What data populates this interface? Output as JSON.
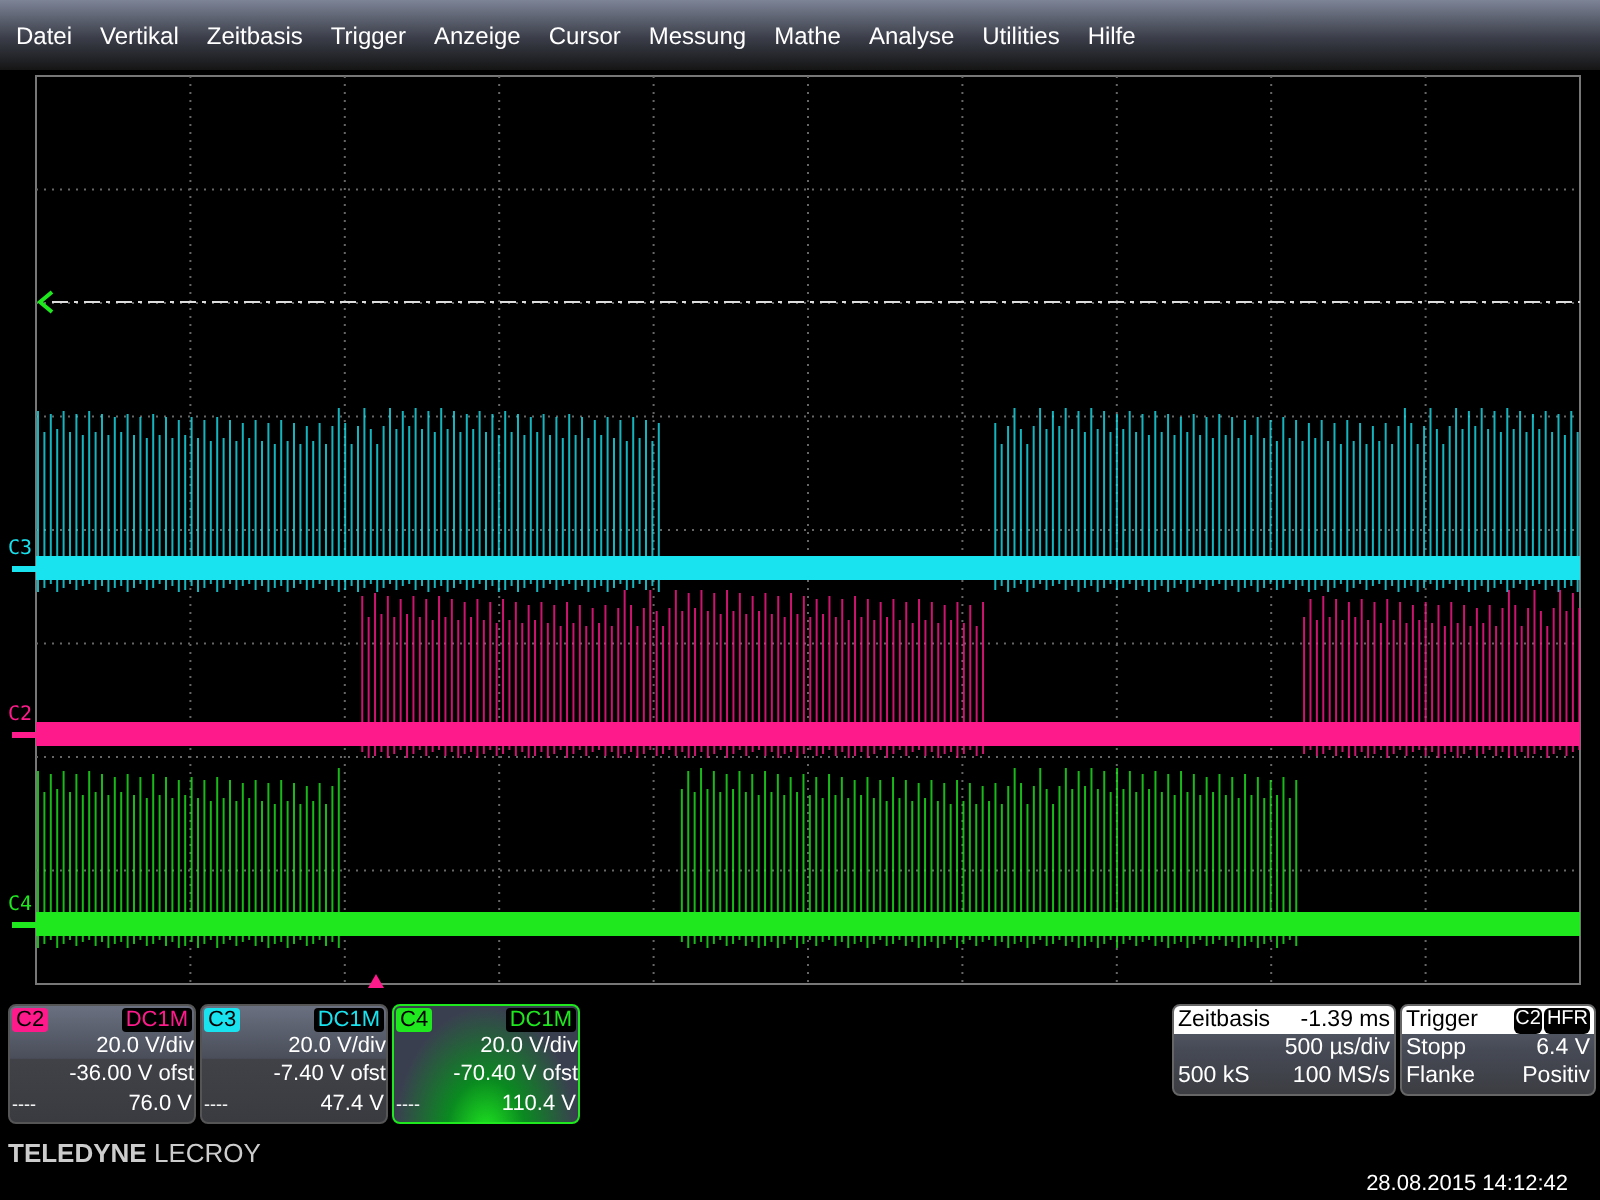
{
  "menu": [
    "Datei",
    "Vertikal",
    "Zeitbasis",
    "Trigger",
    "Anzeige",
    "Cursor",
    "Messung",
    "Mathe",
    "Analyse",
    "Utilities",
    "Hilfe"
  ],
  "traces": [
    {
      "label": "C3",
      "color": "#19e3ee"
    },
    {
      "label": "C2",
      "color": "#ff1a8c"
    },
    {
      "label": "C4",
      "color": "#1fe81f"
    }
  ],
  "channels": [
    {
      "label": "C2",
      "color": "#ff1a8c",
      "coupling": "DC1M",
      "vdiv": "20.0 V/div",
      "offset": "-36.00 V ofst",
      "dash": "----",
      "reading": "76.0 V",
      "selected": false
    },
    {
      "label": "C3",
      "color": "#19e3ee",
      "coupling": "DC1M",
      "vdiv": "20.0 V/div",
      "offset": "-7.40 V ofst",
      "dash": "----",
      "reading": "47.4 V",
      "selected": false
    },
    {
      "label": "C4",
      "color": "#1fe81f",
      "coupling": "DC1M",
      "vdiv": "20.0 V/div",
      "offset": "-70.40 V ofst",
      "dash": "----",
      "reading": "110.4 V",
      "selected": true
    }
  ],
  "brand": {
    "bold": "TELEDYNE",
    "light": "LECROY"
  },
  "timebase": {
    "title": "Zeitbasis",
    "delay": "-1.39 ms",
    "rate": "500 µs/div",
    "samples": "500 kS",
    "srate": "100 MS/s"
  },
  "trigger": {
    "title": "Trigger",
    "source": "C2",
    "mode": "HFR",
    "state": "Stopp",
    "level": "6.4 V",
    "type": "Flanke",
    "slope": "Positiv"
  },
  "datetime": "28.08.2015 14:12:42"
}
